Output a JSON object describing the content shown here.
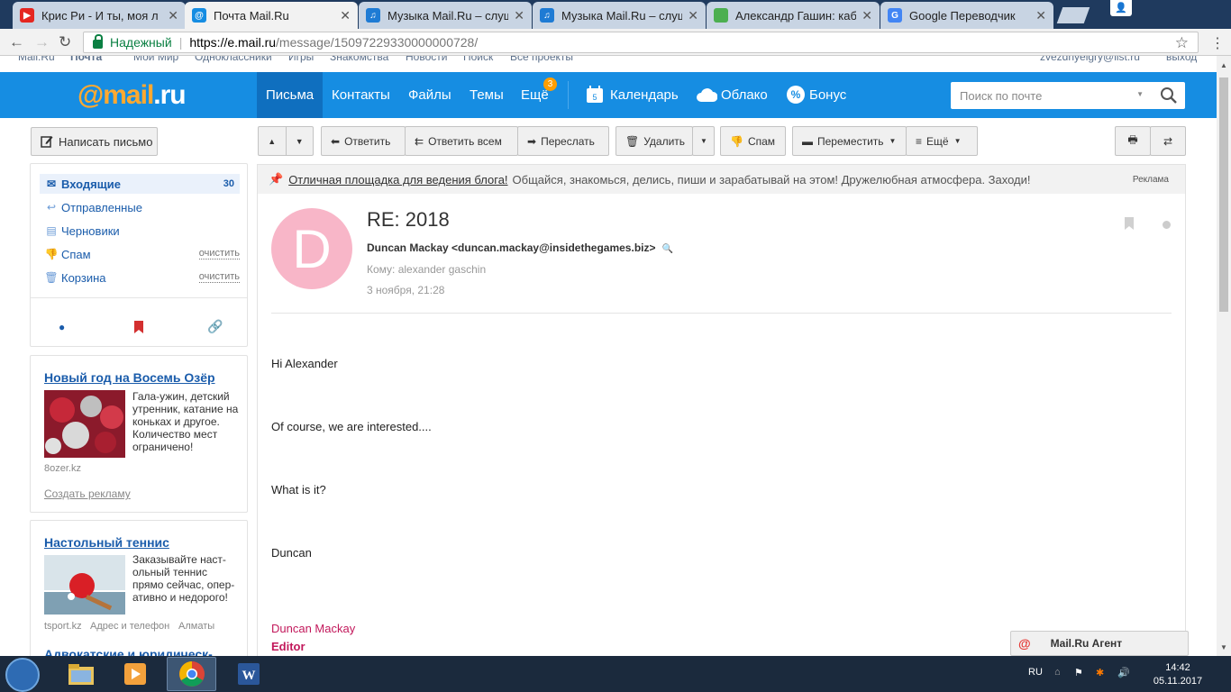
{
  "browser": {
    "tabs": [
      {
        "label": "Крис Ри - И ты, моя л",
        "color": "#e52620",
        "glyph": "▶"
      },
      {
        "label": "Почта Mail.Ru",
        "color": "#168de2",
        "glyph": "@"
      },
      {
        "label": "Музыка Mail.Ru – слуша",
        "color": "#1e7bd4",
        "glyph": "♫"
      },
      {
        "label": "Музыка Mail.Ru – слуша",
        "color": "#1e7bd4",
        "glyph": "♫"
      },
      {
        "label": "Александр Гашин: кабі",
        "color": "#4caf50",
        "glyph": ""
      },
      {
        "label": "Google Переводчик",
        "color": "#4285f4",
        "glyph": "G"
      }
    ],
    "secure_label": "Надежный",
    "url_host": "https://e.mail.ru",
    "url_path": "/message/15097229330000000728/"
  },
  "portal": {
    "items": [
      "Mail.Ru",
      "Почта",
      "Мой Мир",
      "Одноклассники",
      "Игры",
      "Знакомства",
      "Новости",
      "Поиск",
      "Все проекты"
    ],
    "account": "zvezdnyeigry@list.ru",
    "logout": "выход"
  },
  "header": {
    "logo_at": "@mail",
    "logo_ru": ".ru",
    "nav": [
      "Письма",
      "Контакты",
      "Файлы",
      "Темы",
      "Ещё"
    ],
    "more_badge": "3",
    "services": [
      "Календарь",
      "Облако",
      "Бонус"
    ],
    "calendar_day": "5",
    "search_placeholder": "Поиск по почте"
  },
  "sidebar": {
    "compose_label": "Написать письмо",
    "folders": [
      {
        "label": "Входящие",
        "count": "30",
        "clean": ""
      },
      {
        "label": "Отправленные",
        "count": "",
        "clean": ""
      },
      {
        "label": "Черновики",
        "count": "",
        "clean": ""
      },
      {
        "label": "Спам",
        "count": "",
        "clean": "очистить"
      },
      {
        "label": "Корзина",
        "count": "",
        "clean": "очистить"
      }
    ],
    "ads": [
      {
        "title": "Новый год на Восемь Озёр",
        "text": "Гала-ужин, детский утренник, катание на коньках и другое. Количество мест ограничено!",
        "site": "8ozer.kz",
        "create_ad": "Создать рекламу"
      },
      {
        "title": "Настольный теннис",
        "text": "Заказывайте наст-ольный теннис прямо сейчас, опер-ативно и недорого!",
        "site": "tsport.kz",
        "addr": "Адрес и телефон",
        "city": "Алматы"
      },
      {
        "title": "Адвокатские и юридическ-"
      }
    ]
  },
  "toolbar": {
    "reply": "Ответить",
    "reply_all": "Ответить всем",
    "forward": "Переслать",
    "delete": "Удалить",
    "spam": "Спам",
    "move": "Переместить",
    "more": "Ещё"
  },
  "promo": {
    "link": "Отличная площадка для ведения блога!",
    "text": "Общайся, знакомься, делись, пиши и зарабатывай на этом! Дружелюбная атмосфера. Заходи!",
    "label": "Реклама"
  },
  "message": {
    "avatar_letter": "D",
    "subject": "RE: 2018",
    "from": "Duncan Mackay <duncan.mackay@insidethegames.biz>",
    "to": "Кому: alexander gaschin",
    "date": "3 ноября, 21:28",
    "body": [
      "Hi Alexander",
      "Of course, we are interested....",
      "What is it?",
      "Duncan"
    ],
    "signature_name": "Duncan Mackay",
    "signature_role": "Editor"
  },
  "agent": {
    "label": "Mail.Ru Агент"
  },
  "taskbar": {
    "lang": "RU",
    "time": "14:42",
    "date": "05.11.2017"
  }
}
